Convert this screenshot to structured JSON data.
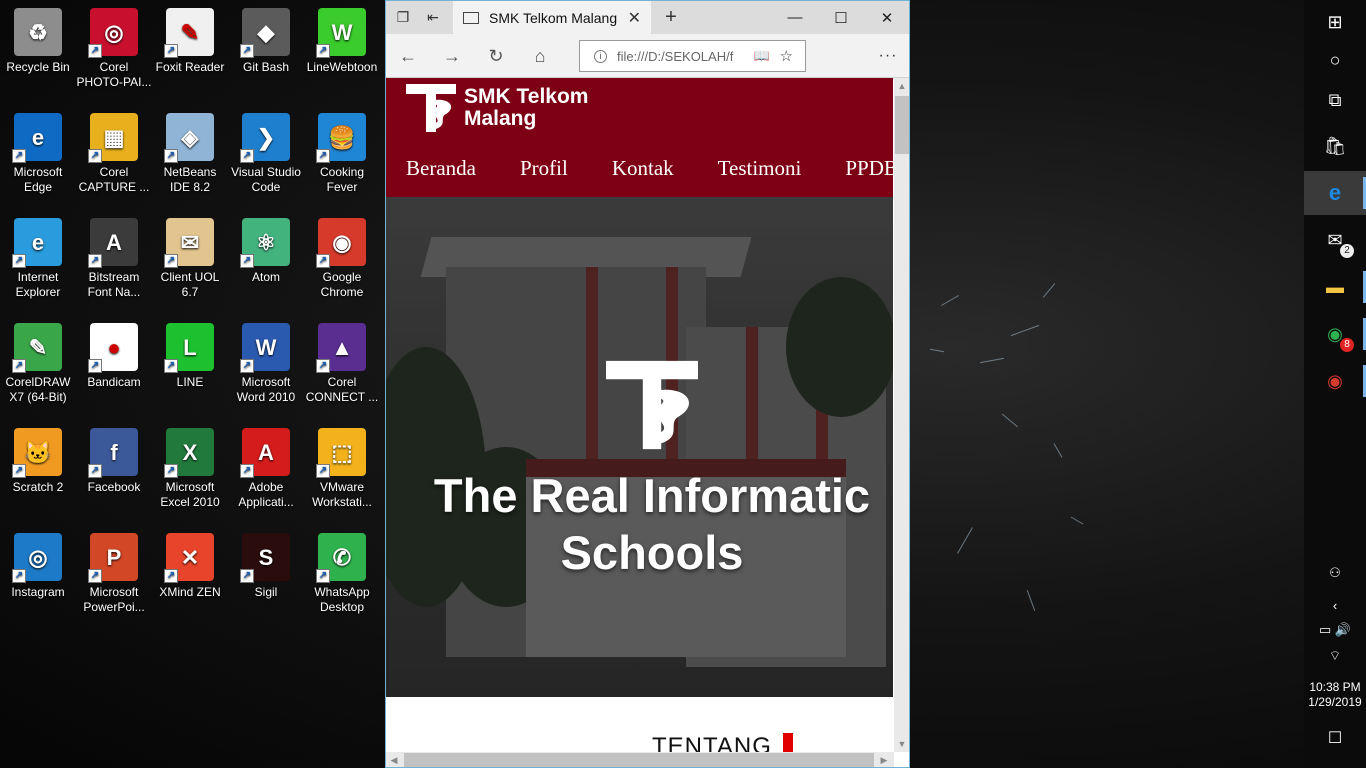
{
  "desktop": {
    "icons": [
      {
        "label": "Recycle Bin",
        "icon": "recycle-bin-icon",
        "color": "#8d8d8d",
        "glyph": "♻"
      },
      {
        "label": "Corel PHOTO-PAI...",
        "icon": "corel-photopaint-icon",
        "color": "#c8102e",
        "glyph": "◎"
      },
      {
        "label": "Foxit Reader",
        "icon": "foxit-reader-icon",
        "color": "#f0f0f0",
        "glyph": "✎"
      },
      {
        "label": "Git Bash",
        "icon": "git-bash-icon",
        "color": "#5b5b5b",
        "glyph": "◆"
      },
      {
        "label": "LineWebtoon",
        "icon": "line-webtoon-icon",
        "color": "#3acb2c",
        "glyph": "W"
      },
      {
        "label": "Microsoft Edge",
        "icon": "microsoft-edge-icon",
        "color": "#0f6ac4",
        "glyph": "e"
      },
      {
        "label": "Corel CAPTURE ...",
        "icon": "corel-capture-icon",
        "color": "#e7b01c",
        "glyph": "▦"
      },
      {
        "label": "NetBeans IDE 8.2",
        "icon": "netbeans-icon",
        "color": "#8fb4d6",
        "glyph": "◈"
      },
      {
        "label": "Visual Studio Code",
        "icon": "vscode-icon",
        "color": "#1e7fcf",
        "glyph": "❯"
      },
      {
        "label": "Cooking Fever",
        "icon": "cooking-fever-icon",
        "color": "#1f86d6",
        "glyph": "🍔"
      },
      {
        "label": "Internet Explorer",
        "icon": "internet-explorer-icon",
        "color": "#2a9bdc",
        "glyph": "e"
      },
      {
        "label": "Bitstream Font Na...",
        "icon": "bitstream-font-icon",
        "color": "#3b3b3b",
        "glyph": "A"
      },
      {
        "label": "Client UOL 6.7",
        "icon": "client-uol-icon",
        "color": "#e1c48e",
        "glyph": "✉"
      },
      {
        "label": "Atom",
        "icon": "atom-icon",
        "color": "#43b37e",
        "glyph": "⚛"
      },
      {
        "label": "Google Chrome",
        "icon": "google-chrome-icon",
        "color": "#d63a2b",
        "glyph": "◉"
      },
      {
        "label": "CorelDRAW X7 (64-Bit)",
        "icon": "coreldraw-icon",
        "color": "#3aa64a",
        "glyph": "✎"
      },
      {
        "label": "Bandicam",
        "icon": "bandicam-icon",
        "color": "#ffffff",
        "glyph": "●"
      },
      {
        "label": "LINE",
        "icon": "line-icon",
        "color": "#1dc12f",
        "glyph": "L"
      },
      {
        "label": "Microsoft Word 2010",
        "icon": "word-icon",
        "color": "#2a5ab0",
        "glyph": "W"
      },
      {
        "label": "Corel CONNECT ...",
        "icon": "corel-connect-icon",
        "color": "#5a2d91",
        "glyph": "▲"
      },
      {
        "label": "Scratch 2",
        "icon": "scratch-icon",
        "color": "#f19a22",
        "glyph": "🐱"
      },
      {
        "label": "Facebook",
        "icon": "facebook-icon",
        "color": "#3b5998",
        "glyph": "f"
      },
      {
        "label": "Microsoft Excel 2010",
        "icon": "excel-icon",
        "color": "#217a3b",
        "glyph": "X"
      },
      {
        "label": "Adobe Applicati...",
        "icon": "adobe-application-icon",
        "color": "#d41c1c",
        "glyph": "A"
      },
      {
        "label": "VMware Workstati...",
        "icon": "vmware-icon",
        "color": "#f3b21b",
        "glyph": "⬚"
      },
      {
        "label": "Instagram",
        "icon": "instagram-icon",
        "color": "#1d7ac8",
        "glyph": "◎"
      },
      {
        "label": "Microsoft PowerPoi...",
        "icon": "powerpoint-icon",
        "color": "#d24726",
        "glyph": "P"
      },
      {
        "label": "XMind ZEN",
        "icon": "xmind-icon",
        "color": "#e7442b",
        "glyph": "✕"
      },
      {
        "label": "Sigil",
        "icon": "sigil-icon",
        "color": "#2a0c0c",
        "glyph": "S"
      },
      {
        "label": "WhatsApp Desktop",
        "icon": "whatsapp-icon",
        "color": "#2fb24d",
        "glyph": "✆"
      }
    ]
  },
  "browser": {
    "tab_title": "SMK Telkom Malang",
    "address": "file:///D:/SEKOLAH/f",
    "site": {
      "brand_line1": "SMK Telkom",
      "brand_line2": "Malang",
      "nav": [
        "Beranda",
        "Profil",
        "Kontak",
        "Testimoni",
        "PPDB"
      ],
      "hero_title_line1": "The Real Informatic",
      "hero_title_line2": "Schools",
      "section_heading": "TENTANG",
      "brand_color": "#7d0014",
      "accent_color": "#e00000"
    }
  },
  "taskbar": {
    "mail_badge": "2",
    "whatsapp_badge": "8",
    "time": "10:38 PM",
    "date": "1/29/2019"
  }
}
